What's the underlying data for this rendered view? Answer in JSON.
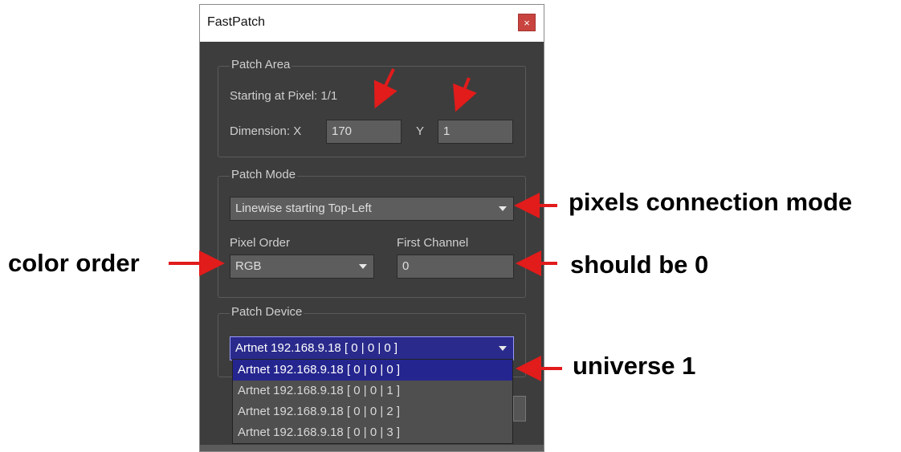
{
  "window": {
    "title": "FastPatch",
    "close_glyph": "×"
  },
  "patch_area": {
    "group_title": "Patch Area",
    "starting_label": "Starting at Pixel: 1/1",
    "dimension_label": "Dimension: X",
    "x_value": "170",
    "y_label": "Y",
    "y_value": "1"
  },
  "patch_mode": {
    "group_title": "Patch Mode",
    "mode_value": "Linewise starting Top-Left",
    "pixel_order_label": "Pixel Order",
    "pixel_order_value": "RGB",
    "first_channel_label": "First Channel",
    "first_channel_value": "0"
  },
  "patch_device": {
    "group_title": "Patch Device",
    "selected": "Artnet 192.168.9.18 [ 0 | 0 | 0 ]",
    "options": [
      "Artnet 192.168.9.18 [ 0 | 0 | 0 ]",
      "Artnet 192.168.9.18 [ 0 | 0 | 1 ]",
      "Artnet 192.168.9.18 [ 0 | 0 | 2 ]",
      "Artnet 192.168.9.18 [ 0 | 0 | 3 ]"
    ]
  },
  "annotations": {
    "pixels_connection_mode": "pixels connection mode",
    "color_order": "color order",
    "should_be_0": "should be 0",
    "universe_1": "universe 1"
  },
  "colors": {
    "arrow": "#e21b1b",
    "selection": "#25258f"
  },
  "icons": [
    "close-icon",
    "chevron-down-icon"
  ]
}
